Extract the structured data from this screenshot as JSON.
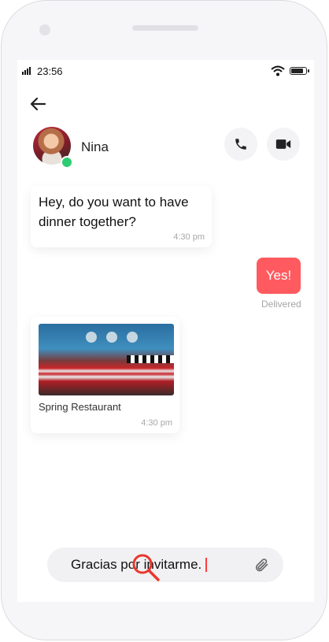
{
  "status_bar": {
    "time": "23:56"
  },
  "contact": {
    "name": "Nina",
    "online": true
  },
  "messages": [
    {
      "direction": "incoming",
      "text": "Hey, do you want to have dinner together?",
      "time": "4:30 pm"
    },
    {
      "direction": "outgoing",
      "text": "Yes!",
      "status": "Delivered"
    },
    {
      "direction": "incoming",
      "type": "image",
      "caption": "Spring Restaurant",
      "time": "4:30 pm"
    }
  ],
  "composer": {
    "value": "Gracias por invitarme."
  },
  "icons": {
    "back": "arrow-left-icon",
    "call": "phone-icon",
    "video": "video-camera-icon",
    "attach": "paperclip-icon",
    "cursor": "magnifier-icon"
  },
  "colors": {
    "accent": "#ff5a5f",
    "online": "#2ecc71",
    "caret": "#ff3b3b"
  }
}
